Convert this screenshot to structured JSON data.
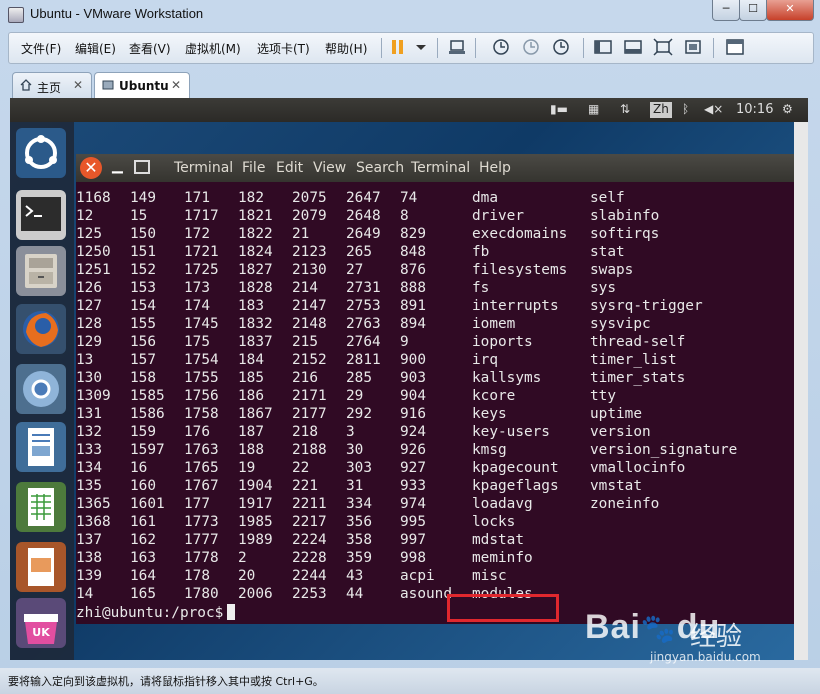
{
  "window": {
    "title": "Ubuntu - VMware Workstation"
  },
  "menubar": {
    "items": [
      "文件(F)",
      "编辑(E)",
      "查看(V)",
      "虚拟机(M)",
      "选项卡(T)",
      "帮助(H)"
    ]
  },
  "tabs": [
    {
      "label": "主页"
    },
    {
      "label": "Ubuntu"
    }
  ],
  "ubuntu_panel": {
    "lang": "Zh",
    "clock": "10:16"
  },
  "terminal": {
    "menu": [
      "Terminal",
      "File",
      "Edit",
      "View",
      "Search",
      "Terminal",
      "Help"
    ],
    "rows": [
      [
        "1168",
        "149",
        "171",
        "182",
        "2075",
        "2647",
        "74",
        "",
        "dma",
        "self"
      ],
      [
        "12",
        "15",
        "1717",
        "1821",
        "2079",
        "2648",
        "8",
        "",
        "driver",
        "slabinfo"
      ],
      [
        "125",
        "150",
        "172",
        "1822",
        "21",
        "2649",
        "829",
        "",
        "execdomains",
        "softirqs"
      ],
      [
        "1250",
        "151",
        "1721",
        "1824",
        "2123",
        "265",
        "848",
        "",
        "fb",
        "stat"
      ],
      [
        "1251",
        "152",
        "1725",
        "1827",
        "2130",
        "27",
        "876",
        "",
        "filesystems",
        "swaps"
      ],
      [
        "126",
        "153",
        "173",
        "1828",
        "214",
        "2731",
        "888",
        "",
        "fs",
        "sys"
      ],
      [
        "127",
        "154",
        "174",
        "183",
        "2147",
        "2753",
        "891",
        "",
        "interrupts",
        "sysrq-trigger"
      ],
      [
        "128",
        "155",
        "1745",
        "1832",
        "2148",
        "2763",
        "894",
        "",
        "iomem",
        "sysvipc"
      ],
      [
        "129",
        "156",
        "175",
        "1837",
        "215",
        "2764",
        "9",
        "",
        "ioports",
        "thread-self"
      ],
      [
        "13",
        "157",
        "1754",
        "184",
        "2152",
        "2811",
        "900",
        "",
        "irq",
        "timer_list"
      ],
      [
        "130",
        "158",
        "1755",
        "185",
        "216",
        "285",
        "903",
        "",
        "kallsyms",
        "timer_stats"
      ],
      [
        "1309",
        "1585",
        "1756",
        "186",
        "2171",
        "29",
        "904",
        "",
        "kcore",
        "tty"
      ],
      [
        "131",
        "1586",
        "1758",
        "1867",
        "2177",
        "292",
        "916",
        "",
        "keys",
        "uptime"
      ],
      [
        "132",
        "159",
        "176",
        "187",
        "218",
        "3",
        "924",
        "",
        "key-users",
        "version"
      ],
      [
        "133",
        "1597",
        "1763",
        "188",
        "2188",
        "30",
        "926",
        "",
        "kmsg",
        "version_signature"
      ],
      [
        "134",
        "16",
        "1765",
        "19",
        "22",
        "303",
        "927",
        "",
        "kpagecount",
        "vmallocinfo"
      ],
      [
        "135",
        "160",
        "1767",
        "1904",
        "221",
        "31",
        "933",
        "",
        "kpageflags",
        "vmstat"
      ],
      [
        "1365",
        "1601",
        "177",
        "1917",
        "2211",
        "334",
        "974",
        "",
        "loadavg",
        "zoneinfo"
      ],
      [
        "1368",
        "161",
        "1773",
        "1985",
        "2217",
        "356",
        "995",
        "",
        "locks",
        ""
      ],
      [
        "137",
        "162",
        "1777",
        "1989",
        "2224",
        "358",
        "997",
        "",
        "mdstat",
        ""
      ],
      [
        "138",
        "163",
        "1778",
        "2",
        "2228",
        "359",
        "998",
        "",
        "meminfo",
        ""
      ],
      [
        "139",
        "164",
        "178",
        "20",
        "2244",
        "43",
        "acpi",
        "",
        "misc",
        ""
      ],
      [
        "14",
        "165",
        "1780",
        "2006",
        "2253",
        "44",
        "asound",
        "",
        "modules",
        ""
      ]
    ],
    "prompt": "zhi@ubuntu:/proc$"
  },
  "statusbar": {
    "message": "要将输入定向到该虚拟机，请将鼠标指针移入其中或按 Ctrl+G。"
  },
  "watermark": {
    "brand": "Bai",
    "paw": "du",
    "jingyan": "经验",
    "url": "jingyan.baidu.com"
  }
}
